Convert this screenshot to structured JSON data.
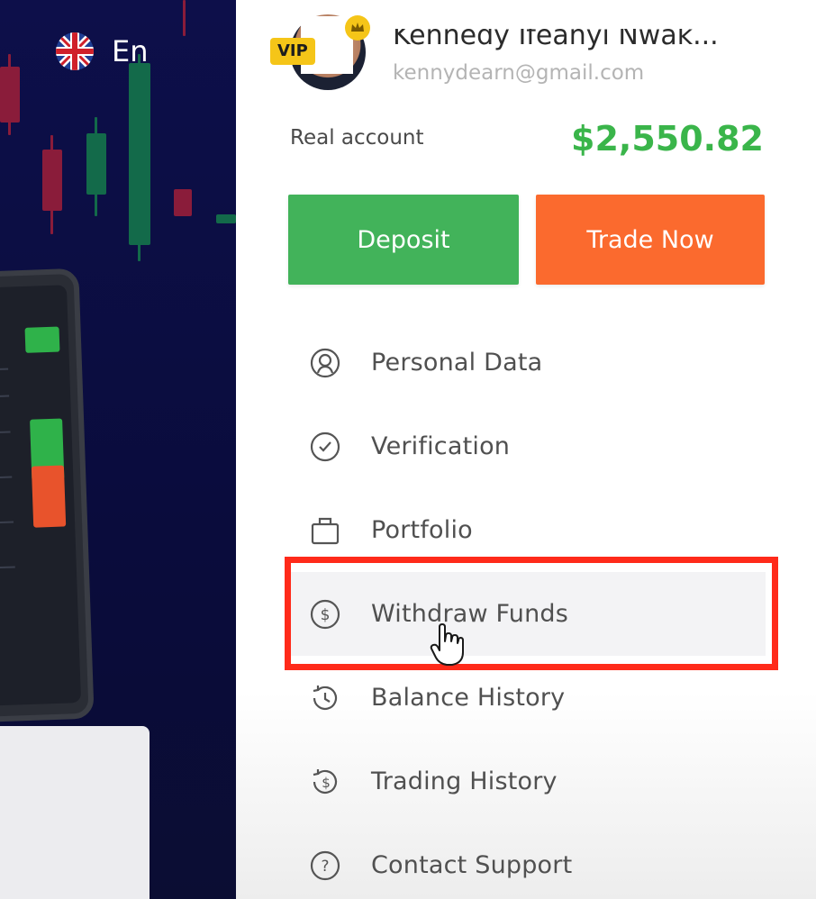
{
  "language": {
    "label": "En",
    "icon": "uk-flag-icon"
  },
  "user": {
    "name": "Kennedy Ifeanyi Nwak...",
    "email": "kennydearn@gmail.com",
    "badge": "VIP",
    "avatar_icon": "user-avatar",
    "crown_icon": "crown-icon"
  },
  "account": {
    "label": "Real account",
    "balance": "$2,550.82"
  },
  "buttons": {
    "deposit": "Deposit",
    "trade_now": "Trade Now"
  },
  "menu": [
    {
      "label": "Personal Data",
      "icon": "person-icon"
    },
    {
      "label": "Verification",
      "icon": "check-circle-icon"
    },
    {
      "label": "Portfolio",
      "icon": "briefcase-icon"
    },
    {
      "label": "Withdraw Funds",
      "icon": "dollar-circle-icon",
      "active": true
    },
    {
      "label": "Balance History",
      "icon": "history-clock-icon"
    },
    {
      "label": "Trading History",
      "icon": "history-dollar-icon"
    },
    {
      "label": "Contact Support",
      "icon": "question-circle-icon"
    }
  ],
  "colors": {
    "balance_green": "#3ab54a",
    "deposit_green": "#42b35a",
    "trade_orange": "#fb6a2e",
    "highlight_red": "#ff2a1a",
    "left_bg": "#0d0f4a"
  }
}
